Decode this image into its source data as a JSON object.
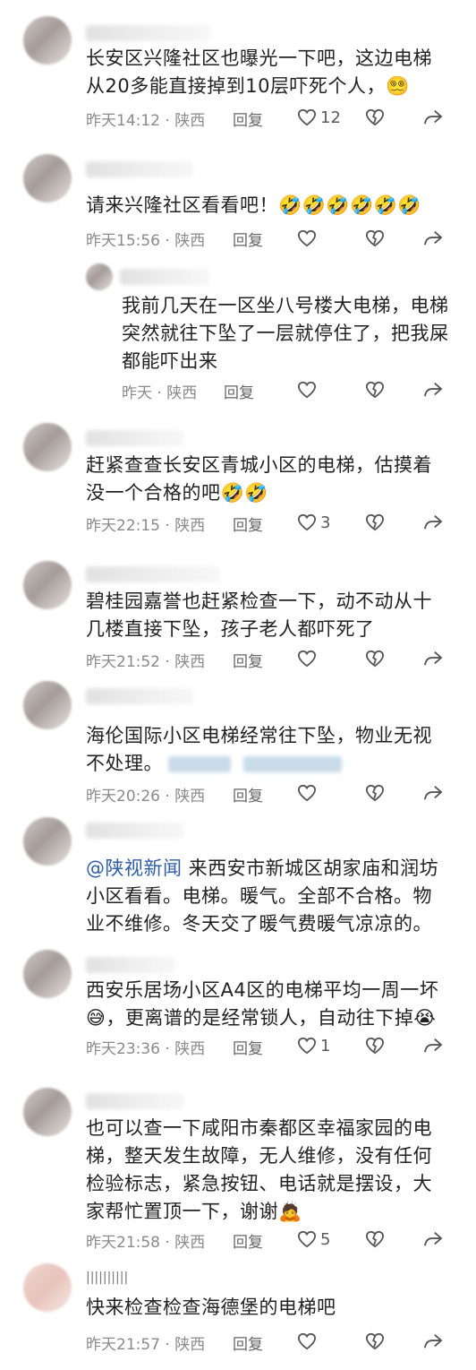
{
  "comments": [
    {
      "text": "长安区兴隆社区也曝光一下吧，这边电梯从20多能直接掉到10层吓死个人，",
      "emoji": "😵‍💫",
      "time": "昨天14:12",
      "location": "陕西",
      "reply": "回复",
      "likes": "12"
    },
    {
      "text": "请来兴隆社区看看吧！",
      "emoji": "🤣🤣🤣🤣🤣🤣",
      "time": "昨天15:56",
      "location": "陕西",
      "reply": "回复",
      "likes": ""
    },
    {
      "text": "我前几天在一区坐八号楼大电梯，电梯突然就往下坠了一层就停住了，把我屎都能吓出来",
      "emoji": "",
      "time": "昨天",
      "location": "陕西",
      "reply": "回复",
      "likes": ""
    },
    {
      "text": "赶紧查查长安区青城小区的电梯，估摸着没一个合格的吧",
      "emoji": "🤣🤣",
      "time": "昨天22:15",
      "location": "陕西",
      "reply": "回复",
      "likes": "3"
    },
    {
      "text": "碧桂园嘉誉也赶紧检查一下，动不动从十几楼直接下坠，孩子老人都吓死了",
      "emoji": "",
      "time": "昨天21:52",
      "location": "陕西",
      "reply": "回复",
      "likes": ""
    },
    {
      "text": "海伦国际小区电梯经常往下坠，物业无视不处理。",
      "emoji": "",
      "time": "昨天20:26",
      "location": "陕西",
      "reply": "回复",
      "likes": ""
    },
    {
      "mention": "@陕视新闻",
      "text": " 来西安市新城区胡家庙和润坊小区看看。电梯。暖气。全部不合格。物业不维修。冬天交了暖气费暖气凉凉的。",
      "emoji": "",
      "time": "",
      "location": "",
      "reply": "",
      "likes": ""
    },
    {
      "text": "西安乐居场小区A4区的电梯平均一周一坏",
      "emoji_mid": "😅",
      "text2": "，更离谱的是经常锁人，自动往下掉",
      "emoji": "😭",
      "time": "昨天23:36",
      "location": "陕西",
      "reply": "回复",
      "likes": "1"
    },
    {
      "text": "也可以查一下咸阳市秦都区幸福家园的电梯，整天发生故障，无人维修，没有任何检验标志，紧急按钮、电话就是摆设，大家帮忙置顶一下，谢谢",
      "emoji": "🙇",
      "time": "昨天21:58",
      "location": "陕西",
      "reply": "回复",
      "likes": "5"
    },
    {
      "name": "||||||||||",
      "text": "快来检查检查海德堡的电梯吧",
      "emoji": "",
      "time": "昨天21:57",
      "location": "陕西",
      "reply": "回复",
      "likes": ""
    }
  ],
  "icons": {
    "like": "heart-outline-icon",
    "dislike": "broken-heart-icon",
    "share": "share-arrow-icon"
  },
  "colors": {
    "mention": "#2d5fa8",
    "meta": "#8a8a8a"
  }
}
